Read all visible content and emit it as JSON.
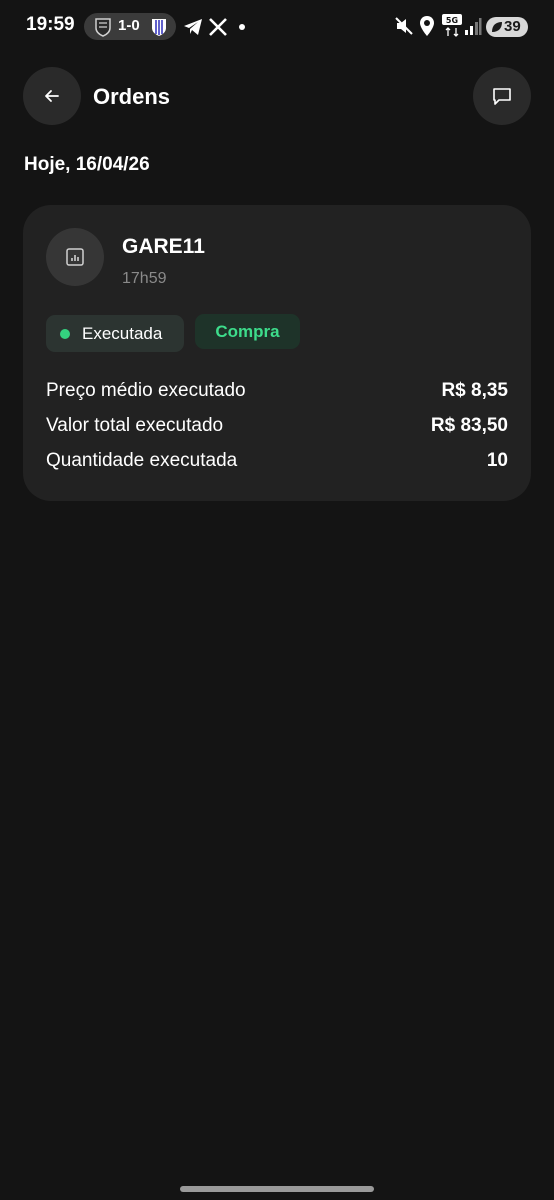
{
  "status_bar": {
    "time": "19:59",
    "match_score": "1-0",
    "battery_level": "39"
  },
  "header": {
    "title": "Ordens"
  },
  "date_label": "Hoje, 16/04/26",
  "order": {
    "ticker": "GARE11",
    "time": "17h59",
    "status": "Executada",
    "side": "Compra",
    "details": [
      {
        "label": "Preço médio executado",
        "value": "R$ 8,35"
      },
      {
        "label": "Valor total executado",
        "value": "R$ 83,50"
      },
      {
        "label": "Quantidade executada",
        "value": "10"
      }
    ]
  },
  "colors": {
    "background": "#141414",
    "card": "#222222",
    "status_green": "#34d17f",
    "buy_green": "#3ddc8b"
  },
  "icons": {
    "back": "arrow-left-icon",
    "chat": "chat-bubble-icon",
    "asset": "chart-icon"
  }
}
